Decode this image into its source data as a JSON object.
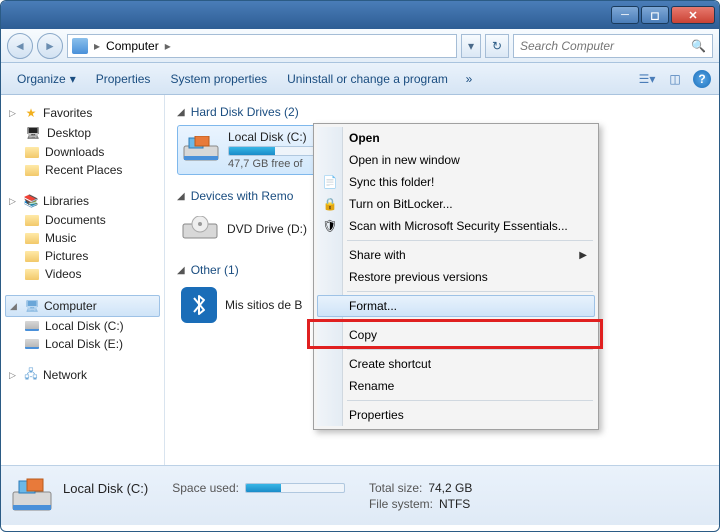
{
  "breadcrumb": {
    "root_icon": "computer",
    "location": "Computer",
    "sep": "▸"
  },
  "search": {
    "placeholder": "Search Computer"
  },
  "toolbar": {
    "organize": "Organize",
    "properties": "Properties",
    "system_properties": "System properties",
    "uninstall": "Uninstall or change a program",
    "more": "»"
  },
  "sidebar": {
    "favorites": {
      "label": "Favorites",
      "items": [
        "Desktop",
        "Downloads",
        "Recent Places"
      ]
    },
    "libraries": {
      "label": "Libraries",
      "items": [
        "Documents",
        "Music",
        "Pictures",
        "Videos"
      ]
    },
    "computer": {
      "label": "Computer",
      "items": [
        "Local Disk (C:)",
        "Local Disk (E:)"
      ]
    },
    "network": {
      "label": "Network"
    }
  },
  "sections": {
    "hdd": {
      "title": "Hard Disk Drives (2)",
      "drives": [
        {
          "name": "Local Disk (C:)",
          "free_text": "47,7 GB free of",
          "fill_pct": 36
        },
        {
          "name": "Local Disk (E:)",
          "free_text": "",
          "fill_pct": 0
        }
      ]
    },
    "removable": {
      "title": "Devices with Remo",
      "items": [
        {
          "name": "DVD Drive (D:)"
        }
      ]
    },
    "other": {
      "title": "Other (1)",
      "items": [
        {
          "name": "Mis sitios de B"
        }
      ]
    }
  },
  "context_menu": {
    "open": "Open",
    "open_new": "Open in new window",
    "sync": "Sync this folder!",
    "bitlocker": "Turn on BitLocker...",
    "scan": "Scan with Microsoft Security Essentials...",
    "share": "Share with",
    "restore": "Restore previous versions",
    "format": "Format...",
    "copy": "Copy",
    "shortcut": "Create shortcut",
    "rename": "Rename",
    "properties": "Properties"
  },
  "status": {
    "title": "Local Disk (C:)",
    "labels": {
      "space_used": "Space used:",
      "total_size": "Total size:",
      "file_system": "File system:"
    },
    "values": {
      "total_size": "74,2 GB",
      "file_system": "NTFS"
    },
    "fill_pct": 36
  }
}
